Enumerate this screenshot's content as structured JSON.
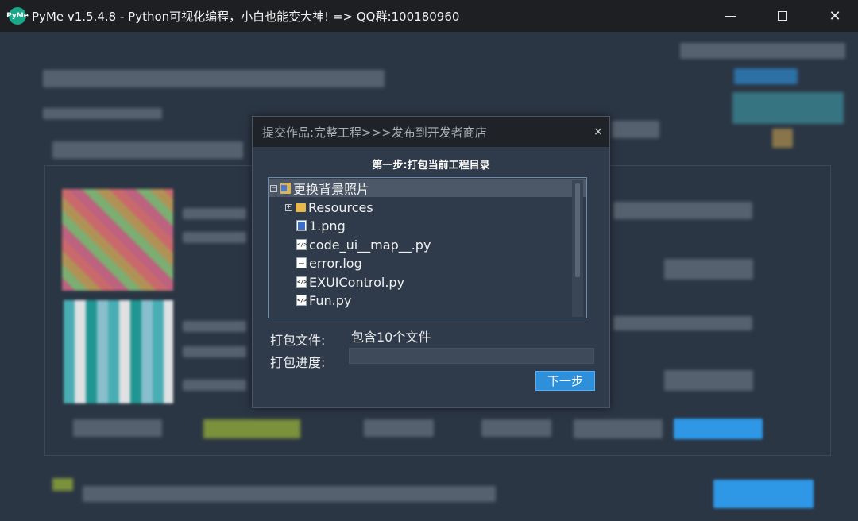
{
  "window": {
    "logo_text": "PyMe",
    "title": "PyMe v1.5.4.8 - Python可视化编程，小白也能变大神!   => QQ群:100180960"
  },
  "dialog": {
    "title": "提交作品:完整工程>>>发布到开发者商店",
    "close_glyph": "×",
    "step_title": "第一步:打包当前工程目录",
    "tree": [
      {
        "label": "更换背景照片",
        "icon": "project-folder-icon",
        "expander": "−",
        "level": 0,
        "selected": true
      },
      {
        "label": "Resources",
        "icon": "folder-icon",
        "expander": "+",
        "level": 1,
        "selected": false
      },
      {
        "label": "1.png",
        "icon": "image-file-icon",
        "expander": "",
        "level": 1,
        "selected": false
      },
      {
        "label": "code_ui__map__.py",
        "icon": "python-file-icon",
        "expander": "",
        "level": 1,
        "selected": false
      },
      {
        "label": "error.log",
        "icon": "text-file-icon",
        "expander": "",
        "level": 1,
        "selected": false
      },
      {
        "label": "EXUIControl.py",
        "icon": "python-file-icon",
        "expander": "",
        "level": 1,
        "selected": false
      },
      {
        "label": "Fun.py",
        "icon": "python-file-icon",
        "expander": "",
        "level": 1,
        "selected": false
      }
    ],
    "pack_files_label": "打包文件:",
    "pack_files_value": "包含10个文件",
    "pack_progress_label": "打包进度:",
    "progress_fraction": 0,
    "next_button": "下一步"
  },
  "colors": {
    "accent": "#2e8fdb",
    "background": "#2b3644",
    "titlebar": "#1d1f22"
  }
}
